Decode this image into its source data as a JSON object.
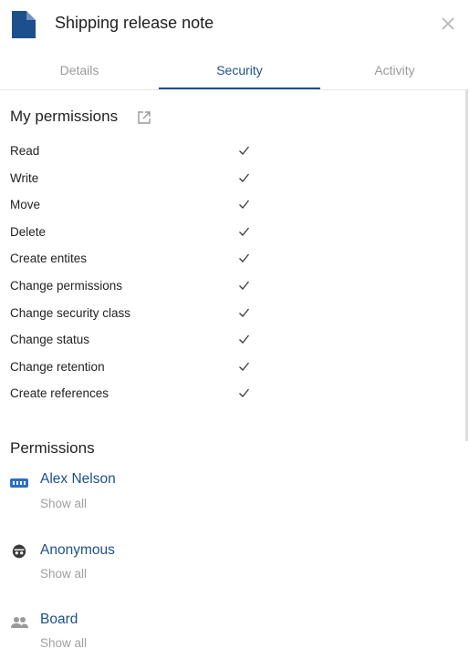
{
  "header": {
    "title": "Shipping release note",
    "doc_icon": "document-icon",
    "close_icon": "close-icon"
  },
  "tabs": [
    {
      "label": "Details",
      "active": false
    },
    {
      "label": "Security",
      "active": true
    },
    {
      "label": "Activity",
      "active": false
    }
  ],
  "my_permissions": {
    "title": "My permissions",
    "icon": "external-link-icon",
    "items": [
      {
        "label": "Read",
        "granted": true
      },
      {
        "label": "Write",
        "granted": true
      },
      {
        "label": "Move",
        "granted": true
      },
      {
        "label": "Delete",
        "granted": true
      },
      {
        "label": "Create entites",
        "granted": true
      },
      {
        "label": "Change permissions",
        "granted": true
      },
      {
        "label": "Change security class",
        "granted": true
      },
      {
        "label": "Change status",
        "granted": true
      },
      {
        "label": "Change retention",
        "granted": true
      },
      {
        "label": "Create references",
        "granted": true
      }
    ]
  },
  "permissions": {
    "title": "Permissions",
    "entries": [
      {
        "name": "Alex Nelson",
        "icon": "user-badge-icon",
        "show_all": "Show all"
      },
      {
        "name": "Anonymous",
        "icon": "anonymous-icon",
        "show_all": "Show all"
      },
      {
        "name": "Board",
        "icon": "group-icon",
        "show_all": "Show all"
      }
    ]
  },
  "colors": {
    "accent": "#1d4f8c",
    "muted": "#a0a0a0",
    "text": "#222222"
  }
}
